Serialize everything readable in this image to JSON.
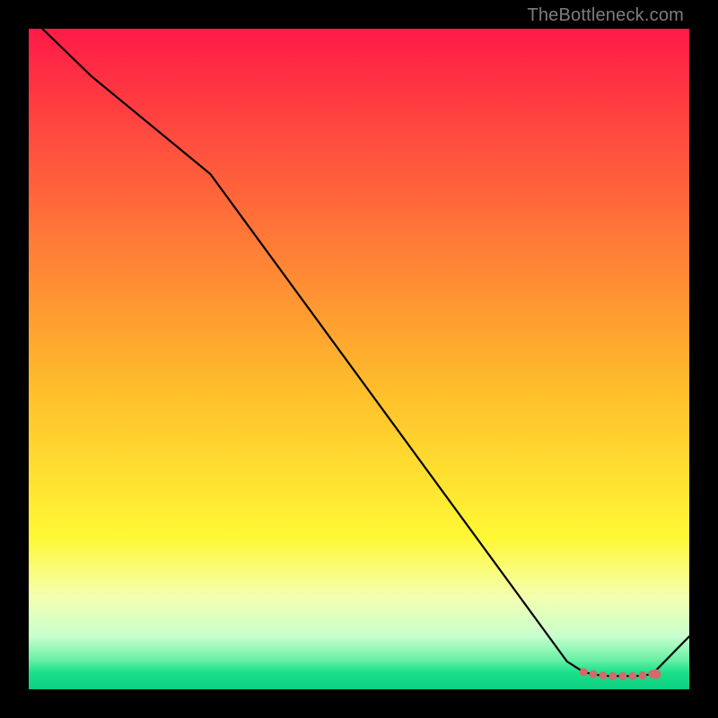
{
  "watermark": {
    "text": "TheBottleneck.com"
  },
  "colors": {
    "background": "#000000",
    "curve": "#000000",
    "marker": "#d46a6a",
    "gradient_stops": [
      {
        "pos": 0.0,
        "color": "#ff1a47"
      },
      {
        "pos": 0.55,
        "color": "#ffbf2b"
      },
      {
        "pos": 0.77,
        "color": "#fff835"
      },
      {
        "pos": 0.86,
        "color": "#f4ffb0"
      },
      {
        "pos": 0.92,
        "color": "#c7ffce"
      },
      {
        "pos": 0.955,
        "color": "#6af0a6"
      },
      {
        "pos": 0.975,
        "color": "#19e08a"
      },
      {
        "pos": 1.0,
        "color": "#0ecf83"
      }
    ]
  },
  "chart_data": {
    "type": "line",
    "title": "",
    "xlabel": "",
    "ylabel": "",
    "xlim": [
      0,
      100
    ],
    "ylim": [
      0,
      100
    ],
    "series": [
      {
        "name": "curve",
        "x": [
          0.0,
          9.5,
          27.5,
          81.5,
          84.0,
          85.3,
          86.6,
          87.9,
          89.2,
          90.5,
          91.8,
          93.1,
          94.4,
          100.0
        ],
        "y": [
          102.0,
          92.8,
          78.0,
          4.2,
          2.6,
          2.3,
          2.1,
          2.0,
          2.0,
          2.0,
          2.0,
          2.1,
          2.3,
          8.0
        ]
      },
      {
        "name": "markers",
        "x": [
          84.0,
          85.3,
          86.6,
          87.9,
          89.2,
          90.5,
          91.8,
          93.1,
          94.4
        ],
        "y": [
          2.6,
          2.3,
          2.1,
          2.0,
          2.0,
          2.0,
          2.0,
          2.1,
          2.3
        ]
      }
    ]
  }
}
